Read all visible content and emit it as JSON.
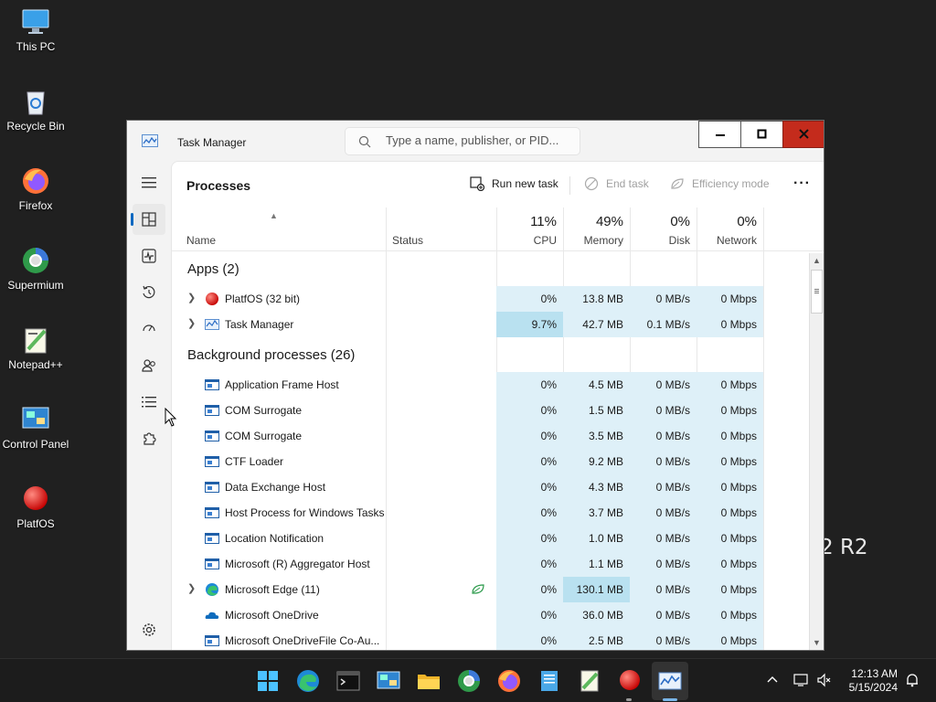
{
  "desktop": {
    "icons": [
      {
        "label": "This PC",
        "icon": "monitor-icon"
      },
      {
        "label": "Recycle Bin",
        "icon": "recycle-bin-icon"
      },
      {
        "label": "Firefox",
        "icon": "firefox-icon"
      },
      {
        "label": "Supermium",
        "icon": "supermium-icon"
      },
      {
        "label": "Notepad++",
        "icon": "notepadpp-icon"
      },
      {
        "label": "Control Panel",
        "icon": "control-panel-icon"
      },
      {
        "label": "PlatfOS",
        "icon": "platfos-icon"
      }
    ],
    "background_text": "2 R2"
  },
  "window": {
    "title": "Task Manager",
    "search_placeholder": "Type a name, publisher, or PID..."
  },
  "page": {
    "title": "Processes",
    "run_new_task": "Run new task",
    "end_task": "End task",
    "efficiency_mode": "Efficiency mode",
    "more": "···"
  },
  "columns": {
    "name": "Name",
    "status": "Status",
    "cpu": {
      "pct": "11%",
      "label": "CPU"
    },
    "memory": {
      "pct": "49%",
      "label": "Memory"
    },
    "disk": {
      "pct": "0%",
      "label": "Disk"
    },
    "network": {
      "pct": "0%",
      "label": "Network"
    }
  },
  "groups": {
    "apps": "Apps (2)",
    "background": "Background processes (26)"
  },
  "apps": [
    {
      "name": "PlatfOS (32 bit)",
      "icon": "platfos-icon",
      "cpu": "0%",
      "memory": "13.8 MB",
      "disk": "0 MB/s",
      "network": "0 Mbps"
    },
    {
      "name": "Task Manager",
      "icon": "task-manager-icon",
      "cpu": "9.7%",
      "memory": "42.7 MB",
      "disk": "0.1 MB/s",
      "network": "0 Mbps"
    }
  ],
  "background": [
    {
      "name": "Application Frame Host",
      "cpu": "0%",
      "memory": "4.5 MB",
      "disk": "0 MB/s",
      "network": "0 Mbps"
    },
    {
      "name": "COM Surrogate",
      "cpu": "0%",
      "memory": "1.5 MB",
      "disk": "0 MB/s",
      "network": "0 Mbps"
    },
    {
      "name": "COM Surrogate",
      "cpu": "0%",
      "memory": "3.5 MB",
      "disk": "0 MB/s",
      "network": "0 Mbps"
    },
    {
      "name": "CTF Loader",
      "cpu": "0%",
      "memory": "9.2 MB",
      "disk": "0 MB/s",
      "network": "0 Mbps"
    },
    {
      "name": "Data Exchange Host",
      "cpu": "0%",
      "memory": "4.3 MB",
      "disk": "0 MB/s",
      "network": "0 Mbps"
    },
    {
      "name": "Host Process for Windows Tasks",
      "cpu": "0%",
      "memory": "3.7 MB",
      "disk": "0 MB/s",
      "network": "0 Mbps"
    },
    {
      "name": "Location Notification",
      "cpu": "0%",
      "memory": "1.0 MB",
      "disk": "0 MB/s",
      "network": "0 Mbps"
    },
    {
      "name": "Microsoft (R) Aggregator Host",
      "cpu": "0%",
      "memory": "1.1 MB",
      "disk": "0 MB/s",
      "network": "0 Mbps"
    },
    {
      "name": "Microsoft Edge (11)",
      "cpu": "0%",
      "memory": "130.1 MB",
      "disk": "0 MB/s",
      "network": "0 Mbps"
    },
    {
      "name": "Microsoft OneDrive",
      "cpu": "0%",
      "memory": "36.0 MB",
      "disk": "0 MB/s",
      "network": "0 Mbps"
    },
    {
      "name": "Microsoft OneDriveFile Co-Au...",
      "cpu": "0%",
      "memory": "2.5 MB",
      "disk": "0 MB/s",
      "network": "0 Mbps"
    }
  ],
  "taskbar": {
    "time": "12:13 AM",
    "date": "5/15/2024"
  },
  "colors": {
    "accent": "#0067c0",
    "close_red": "#c42b1c",
    "heat_light": "#def0f8",
    "heat_medium": "#b9e1f0"
  }
}
